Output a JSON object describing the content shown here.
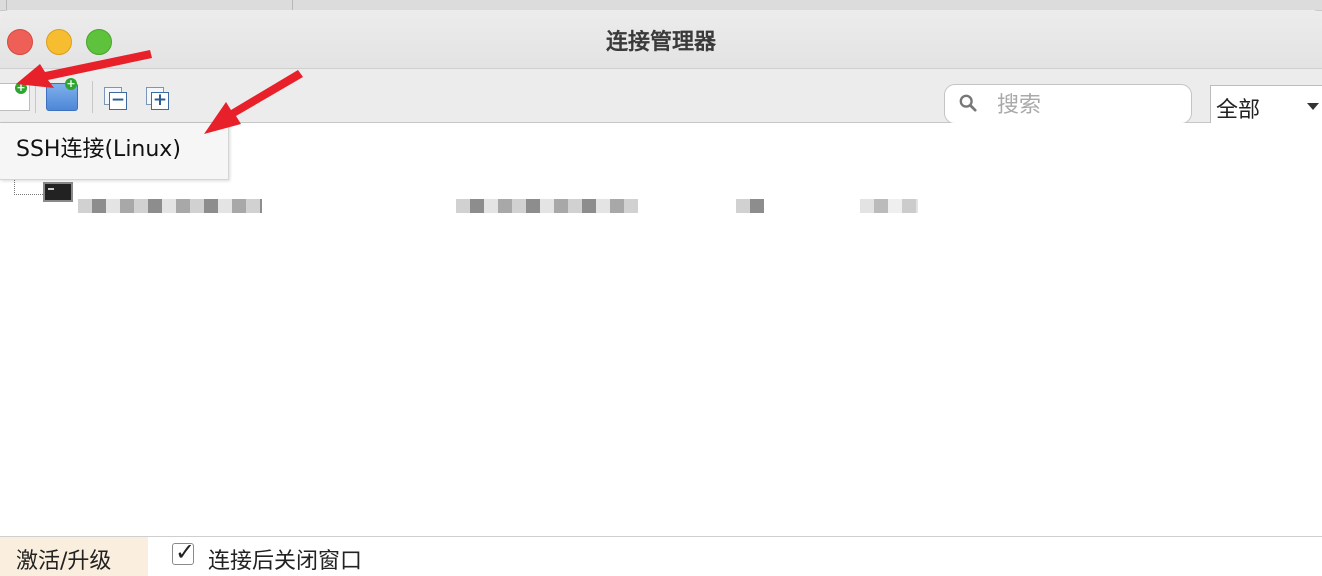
{
  "window": {
    "title": "连接管理器"
  },
  "toolbar": {
    "search_placeholder": "搜索",
    "filter_value": "全部"
  },
  "dropdown": {
    "item": "SSH连接(Linux)"
  },
  "tree": {
    "rows": [
      {
        "icon": "terminal-icon"
      }
    ]
  },
  "footer": {
    "activate_label": "激活/升级",
    "close_after_connect_label": "连接后关闭窗口",
    "close_after_connect_checked": true
  },
  "colors": {
    "annotation_arrow": "#e8202a",
    "accent_green": "#2ea52e"
  }
}
